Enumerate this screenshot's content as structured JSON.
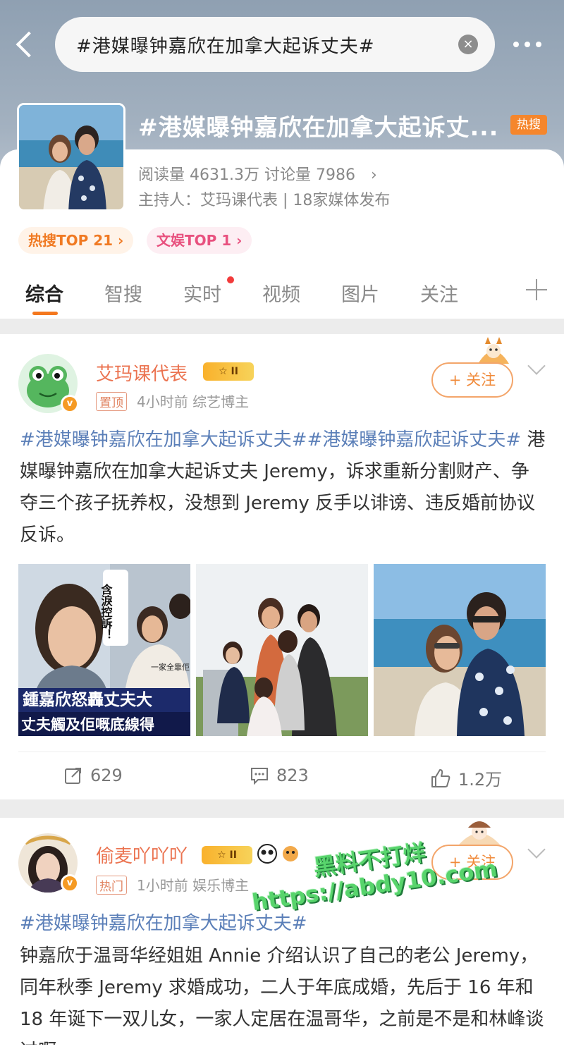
{
  "header": {
    "search_text": "#港媒曝钟嘉欣在加拿大起诉丈夫#",
    "clear_symbol": "×"
  },
  "topic": {
    "title": "#港媒曝钟嘉欣在加拿大起诉丈...",
    "hot_badge": "热搜",
    "stats": "阅读量 4631.3万  讨论量 7986",
    "stats_chevron": "›",
    "host": "主持人：艾玛课代表 | 18家媒体发布",
    "pill_hot": "热搜TOP 21 ›",
    "pill_ent": "文娱TOP 1 ›"
  },
  "tabs": [
    "综合",
    "智搜",
    "实时",
    "视频",
    "图片",
    "关注"
  ],
  "posts": [
    {
      "username": "艾玛课代表",
      "rank_badge": "☆ II",
      "tag": "置顶",
      "meta": "4小时前  综艺博主",
      "follow_label": "+ 关注",
      "topic_tags": "#港媒曝钟嘉欣在加拿大起诉丈夫##港媒曝钟嘉欣起诉丈夫#",
      "body": " 港媒曝钟嘉欣在加拿大起诉丈夫 Jeremy，诉求重新分割财产、争夺三个孩子抚养权，没想到 Jeremy 反手以诽谤、违反婚前协议反诉。",
      "photo1_caption_top": "含淚控訴！",
      "photo1_caption_small": "一家全靠佢",
      "photo1_caption_1": "鍾嘉欣怒轟丈夫大",
      "photo1_caption_2": "丈夫觸及佢嘅底線得",
      "repost_count": "629",
      "comment_count": "823",
      "like_count": "1.2万"
    },
    {
      "username": "偷麦吖吖吖",
      "rank_badge": "☆ II",
      "tag": "热门",
      "meta": "1小时前  娱乐博主",
      "follow_label": "+ 关注",
      "topic_tags": "#港媒曝钟嘉欣在加拿大起诉丈夫#",
      "body": "钟嘉欣于温哥华经姐姐 Annie 介绍认识了自己的老公 Jeremy，同年秋季 Jeremy 求婚成功，二人于年底成婚，先后于 16 年和 18 年诞下一双儿女，一家人定居在温哥华，之前是不是和林峰谈过啊"
    }
  ],
  "watermark": {
    "line1": "黑料不打烊",
    "line2": "https://abdy10.com"
  }
}
